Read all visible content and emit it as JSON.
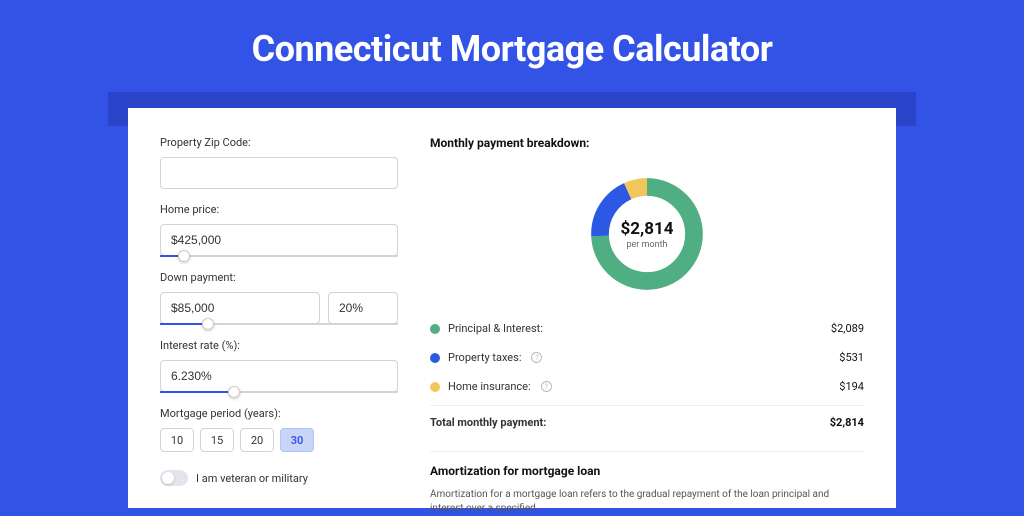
{
  "title": "Connecticut Mortgage Calculator",
  "form": {
    "zip_label": "Property Zip Code:",
    "zip_value": "",
    "price_label": "Home price:",
    "price_value": "$425,000",
    "dp_label": "Down payment:",
    "dp_amount": "$85,000",
    "dp_pct": "20%",
    "rate_label": "Interest rate (%):",
    "rate_value": "6.230%",
    "period_label": "Mortgage period (years):",
    "period_options": [
      "10",
      "15",
      "20",
      "30"
    ],
    "period_selected": "30",
    "veteran_label": "I am veteran or military"
  },
  "breakdown": {
    "heading": "Monthly payment breakdown:",
    "center_amount": "$2,814",
    "center_sub": "per month",
    "items": [
      {
        "label": "Principal & Interest:",
        "value": "$2,089",
        "color": "#4fae82",
        "info": false
      },
      {
        "label": "Property taxes:",
        "value": "$531",
        "color": "#2b59e3",
        "info": true
      },
      {
        "label": "Home insurance:",
        "value": "$194",
        "color": "#f1c75c",
        "info": true
      }
    ],
    "total_label": "Total monthly payment:",
    "total_value": "$2,814"
  },
  "amort": {
    "heading": "Amortization for mortgage loan",
    "text": "Amortization for a mortgage loan refers to the gradual repayment of the loan principal and interest over a specified"
  },
  "colors": {
    "green": "#4fae82",
    "blue": "#2b59e3",
    "yellow": "#f1c75c"
  },
  "chart_data": {
    "type": "pie",
    "title": "Monthly payment breakdown",
    "series": [
      {
        "name": "Principal & Interest",
        "value": 2089
      },
      {
        "name": "Property taxes",
        "value": 531
      },
      {
        "name": "Home insurance",
        "value": 194
      }
    ],
    "total": 2814,
    "unit": "USD per month"
  }
}
